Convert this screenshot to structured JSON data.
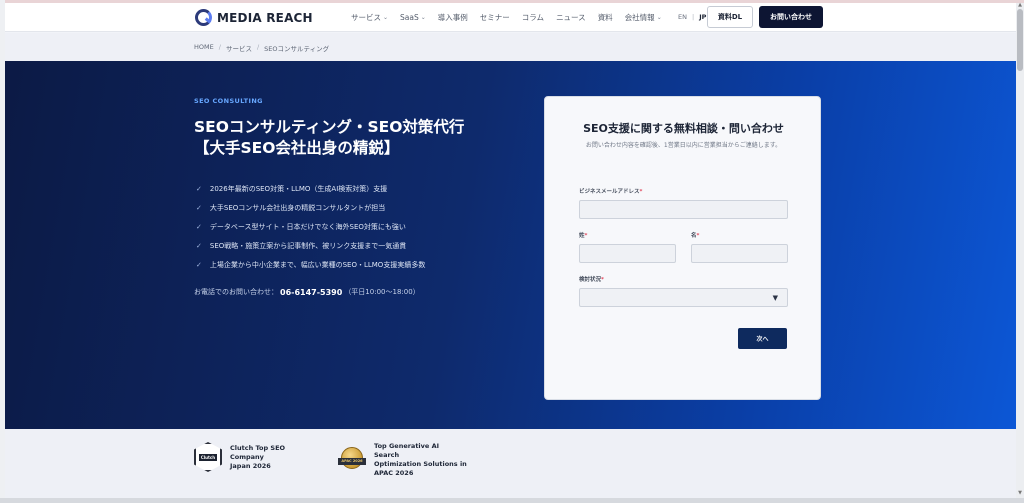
{
  "header": {
    "logo_text": "MEDIA REACH",
    "nav": [
      {
        "label": "サービス",
        "has_dropdown": true
      },
      {
        "label": "SaaS",
        "has_dropdown": true
      },
      {
        "label": "導入事例",
        "has_dropdown": false
      },
      {
        "label": "セミナー",
        "has_dropdown": false
      },
      {
        "label": "コラム",
        "has_dropdown": false
      },
      {
        "label": "ニュース",
        "has_dropdown": false
      },
      {
        "label": "資料",
        "has_dropdown": false
      },
      {
        "label": "会社情報",
        "has_dropdown": true
      }
    ],
    "lang_en": "EN",
    "lang_jp": "JP",
    "lang_sep": "|",
    "download_label": "資料DL",
    "contact_label": "お問い合わせ"
  },
  "breadcrumb": {
    "items": [
      "HOME",
      "サービス",
      "SEOコンサルティング"
    ],
    "sep": "/"
  },
  "hero": {
    "eyebrow": "SEO CONSULTING",
    "title": "SEOコンサルティング・SEO対策代行【大手SEO会社出身の精鋭】",
    "check_glyph": "✓",
    "features": [
      "2026年最新のSEO対策・LLMO（生成AI検索対策）支援",
      "大手SEOコンサル会社出身の精鋭コンサルタントが担当",
      "データベース型サイト・日本だけでなく海外SEO対策にも強い",
      "SEO戦略・施策立案から記事制作、被リンク支援まで一気通貫",
      "上場企業から中小企業まで、幅広い業種のSEO・LLMO支援実績多数"
    ],
    "phone_prefix": "お電話でのお問い合わせ：",
    "phone_number": "06-6147-5390",
    "phone_hours": "（平日10:00〜18:00）"
  },
  "form": {
    "title": "SEO支援に関する無料相談・問い合わせ",
    "subtitle": "お問い合わせ内容を確認後、1営業日以内に営業担当からご連絡します。",
    "email_label": "ビジネスメールアドレス",
    "last_name_label": "姓",
    "first_name_label": "名",
    "status_label": "検討状況",
    "required_mark": "*",
    "select_arrow": "▼",
    "next_label": "次へ"
  },
  "awards": [
    {
      "badge_text": "Clutch",
      "lines": [
        "Clutch Top SEO",
        "Company",
        "Japan 2026"
      ]
    },
    {
      "badge_text": "APAC 2026",
      "lines": [
        "Top Generative AI",
        "Search",
        "Optimization Solutions in",
        "APAC 2026"
      ]
    }
  ],
  "scrollbar": {
    "up": "▲",
    "down": "▼"
  }
}
